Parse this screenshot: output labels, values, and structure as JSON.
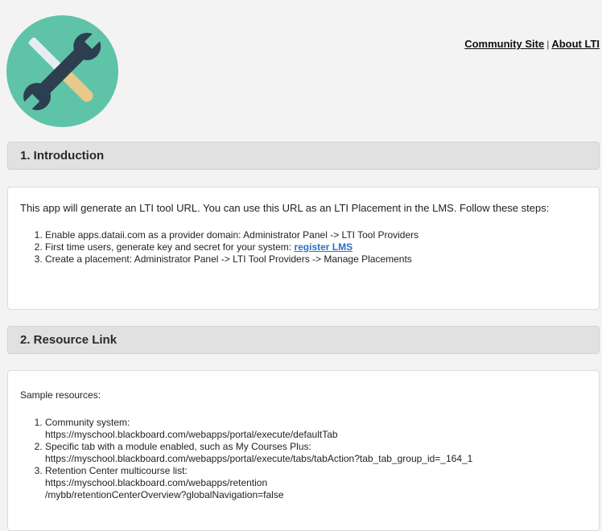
{
  "header": {
    "links": [
      {
        "label": "Community Site"
      },
      {
        "label": "About LTI"
      }
    ],
    "separator": "|"
  },
  "colors": {
    "logo_circle": "#5fc3a8",
    "tool_blade": "#e9c98a",
    "tool_handle": "#2c3e50",
    "link_blue": "#2a6fc7"
  },
  "sections": [
    {
      "title": "1. Introduction",
      "intro": "This app will generate an LTI tool URL. You can use this URL as an LTI Placement in the LMS. Follow these steps:",
      "steps": [
        {
          "text": "Enable apps.dataii.com as a provider domain: Administrator Panel -> LTI Tool Providers"
        },
        {
          "text": "First time users, generate key and secret for your system: ",
          "link": "register LMS"
        },
        {
          "text": "Create a placement: Administrator Panel -> LTI Tool Providers -> Manage Placements"
        }
      ]
    },
    {
      "title": "2. Resource Link",
      "intro": "Sample resources:",
      "items": [
        {
          "label": "Community system:",
          "url": "https://myschool.blackboard.com/webapps/portal/execute/defaultTab"
        },
        {
          "label": "Specific tab with a module enabled, such as My Courses Plus:",
          "url": "https://myschool.blackboard.com/webapps/portal/execute/tabs/tabAction?tab_tab_group_id=_164_1"
        },
        {
          "label": "Retention Center multicourse list:",
          "url": "https://myschool.blackboard.com/webapps/retention",
          "url2": "/mybb/retentionCenterOverview?globalNavigation=false"
        }
      ]
    }
  ]
}
